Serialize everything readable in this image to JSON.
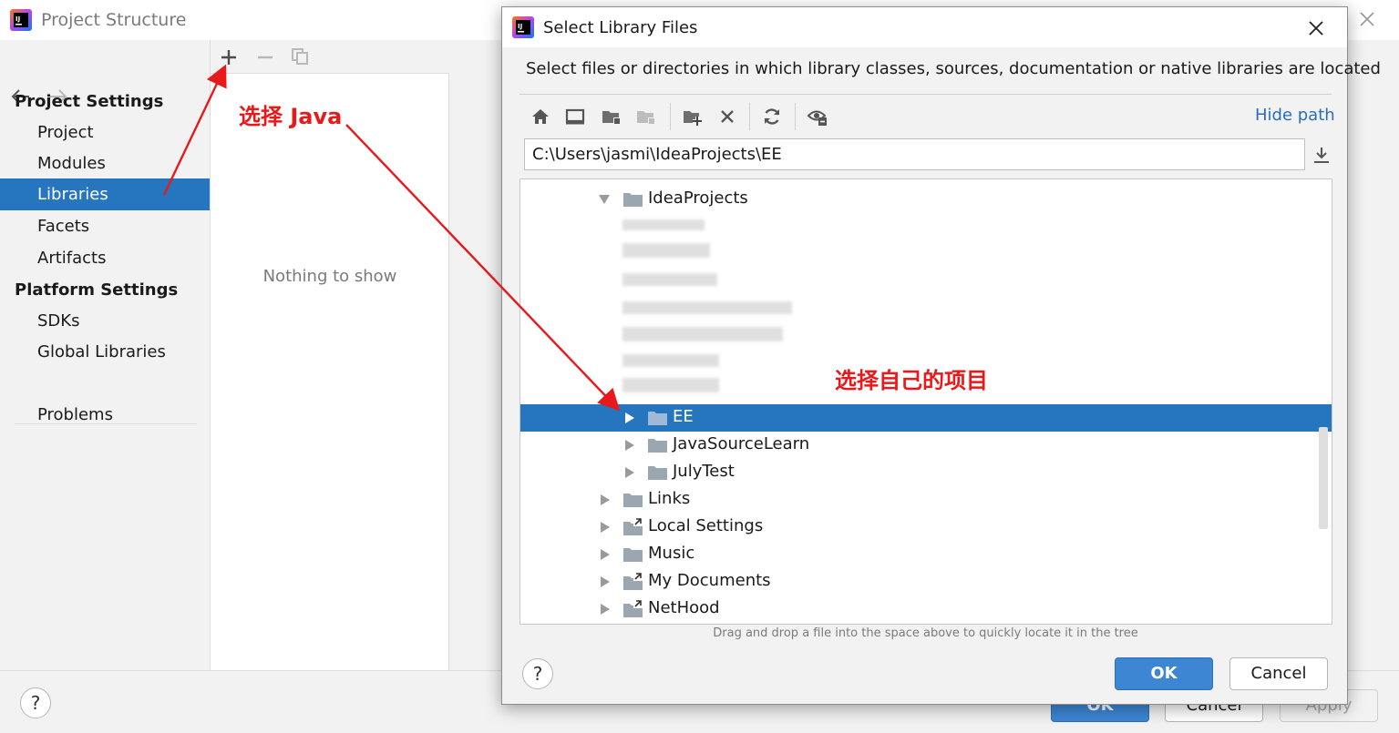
{
  "project_structure": {
    "title": "Project Structure",
    "sidebar": {
      "project_settings_header": "Project Settings",
      "project_items": [
        "Project",
        "Modules",
        "Libraries",
        "Facets",
        "Artifacts"
      ],
      "selected_item": "Libraries",
      "platform_settings_header": "Platform Settings",
      "platform_items": [
        "SDKs",
        "Global Libraries"
      ],
      "problems": "Problems"
    },
    "middle": {
      "empty_text": "Nothing to show"
    },
    "footer": {
      "help": "?",
      "ok_label": "OK",
      "cancel_label": "Cancel",
      "apply_label": "Apply"
    }
  },
  "dialog": {
    "title": "Select Library Files",
    "description": "Select files or directories in which library classes, sources, documentation or native libraries are located",
    "hide_path_label": "Hide path",
    "path_value": "C:\\Users\\jasmi\\IdeaProjects\\EE",
    "toolbar_icons": [
      "home-icon",
      "desktop-icon",
      "project-folder-icon",
      "module-folder-icon",
      "new-folder-icon",
      "delete-icon",
      "refresh-icon",
      "show-hidden-icon"
    ],
    "tree": {
      "root": "IdeaProjects",
      "children": [
        {
          "label": "EE",
          "selected": true
        },
        {
          "label": "JavaSourceLearn",
          "selected": false
        },
        {
          "label": "JulyTest",
          "selected": false
        }
      ],
      "siblings": [
        {
          "label": "Links",
          "icon": "folder"
        },
        {
          "label": "Local Settings",
          "icon": "shortcut-folder"
        },
        {
          "label": "Music",
          "icon": "folder"
        },
        {
          "label": "My Documents",
          "icon": "shortcut-folder"
        },
        {
          "label": "NetHood",
          "icon": "shortcut-folder"
        }
      ]
    },
    "drag_hint": "Drag and drop a file into the space above to quickly locate it in the tree",
    "help": "?",
    "ok_label": "OK",
    "cancel_label": "Cancel"
  },
  "annotations": {
    "select_java": "选择 Java",
    "select_project": "选择自己的项目",
    "color": "#e8191a"
  },
  "colors": {
    "selection": "#2675bf",
    "link": "#2a6ebb",
    "primary_button": "#3d86d4"
  }
}
